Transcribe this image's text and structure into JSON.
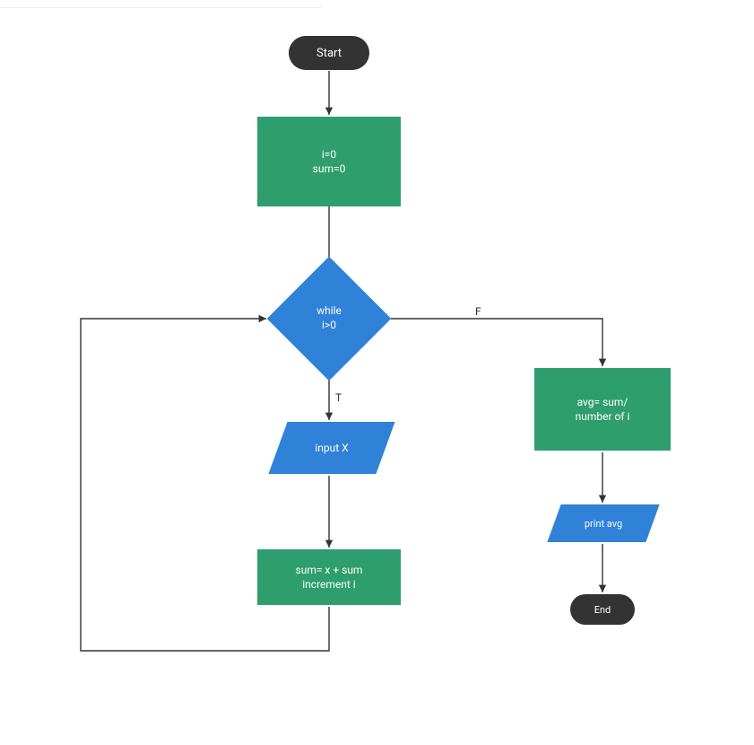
{
  "diagram": {
    "type": "flowchart",
    "colors": {
      "terminator": "#333333",
      "process": "#2f9e6e",
      "decision": "#2f82d8",
      "io": "#2f82d8",
      "arrow": "#333333",
      "background": "#ffffff"
    },
    "nodes": {
      "start": {
        "kind": "terminator",
        "text": "Start"
      },
      "init": {
        "kind": "process",
        "text": "i=0\nsum=0"
      },
      "decision": {
        "kind": "decision",
        "text": "while\ni>0"
      },
      "input": {
        "kind": "io",
        "text": "input X"
      },
      "accumulate": {
        "kind": "process",
        "text": "sum= x + sum\nincrement i"
      },
      "average": {
        "kind": "process",
        "text": "avg= sum/\nnumber of i"
      },
      "print": {
        "kind": "io",
        "text": "print avg"
      },
      "end": {
        "kind": "terminator",
        "text": "End"
      }
    },
    "edges": [
      {
        "from": "start",
        "to": "init",
        "label": ""
      },
      {
        "from": "init",
        "to": "decision",
        "label": ""
      },
      {
        "from": "decision",
        "to": "input",
        "label": "T"
      },
      {
        "from": "input",
        "to": "accumulate",
        "label": ""
      },
      {
        "from": "accumulate",
        "to": "decision",
        "label": ""
      },
      {
        "from": "decision",
        "to": "average",
        "label": "F"
      },
      {
        "from": "average",
        "to": "print",
        "label": ""
      },
      {
        "from": "print",
        "to": "end",
        "label": ""
      }
    ],
    "labels": {
      "true": "T",
      "false": "F"
    }
  }
}
